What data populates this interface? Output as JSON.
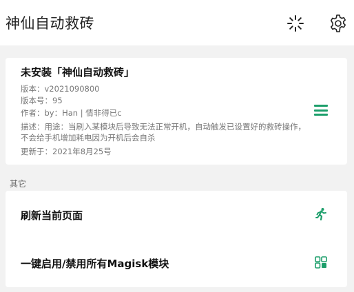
{
  "app": {
    "title": "神仙自动救砖"
  },
  "toolbar": {
    "loading_icon": "loading-spinner-icon",
    "settings_icon": "gear-icon"
  },
  "module": {
    "title": "未安装「神仙自动救砖」",
    "version": "版本：v2021090800",
    "version_code": "版本号：95",
    "author": "作者：by：Han | 情非得已c",
    "description": "描述：用途：当刷入某模块后导致无法正常开机，自动触发已设置好的救砖操作，不会给手机增加耗电因为开机后会自杀",
    "updated": "更新于：2021年8月25号",
    "menu_icon": "menu-icon"
  },
  "section": {
    "label": "其它"
  },
  "actions": [
    {
      "label": "刷新当前页面",
      "icon": "running-icon"
    },
    {
      "label": "一键启用/禁用所有Magisk模块",
      "icon": "modules-icon"
    }
  ],
  "colors": {
    "accent": "#1b9e6a",
    "background": "#f2f2f2",
    "card": "#ffffff"
  }
}
